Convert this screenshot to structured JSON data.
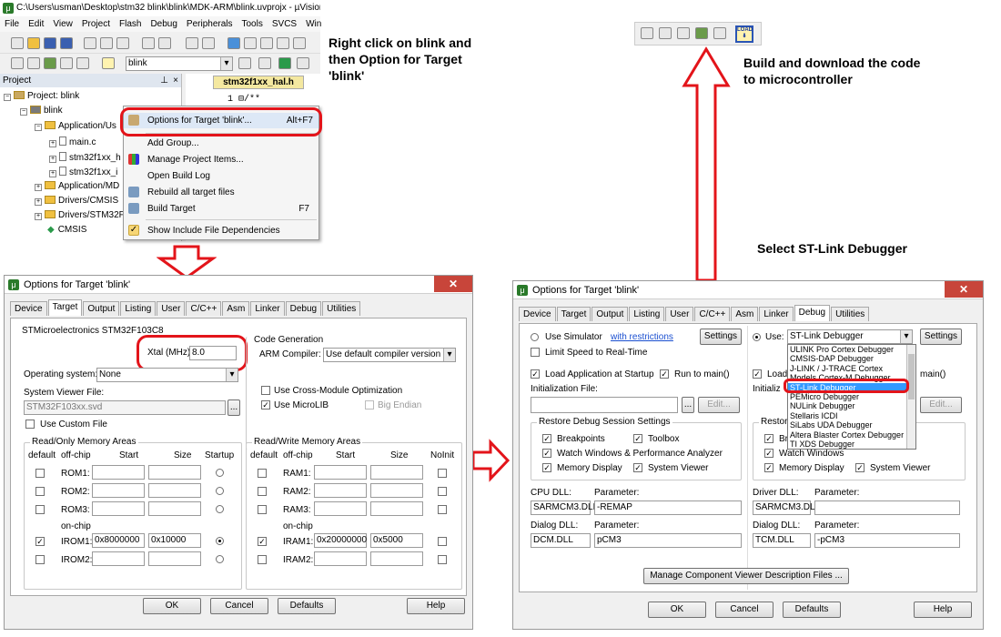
{
  "ide": {
    "title": "C:\\Users\\usman\\Desktop\\stm32 blink\\blink\\MDK-ARM\\blink.uvprojx - µVision",
    "menu": [
      "File",
      "Edit",
      "View",
      "Project",
      "Flash",
      "Debug",
      "Peripherals",
      "Tools",
      "SVCS",
      "Win"
    ],
    "target_value": "blink",
    "editor_tab": "stm32f1xx_hal.h",
    "editor_line": "1 ⊟/**",
    "project_pane_title": "Project",
    "tree": {
      "root": "Project: blink",
      "target": "blink",
      "app_user": "Application/Us",
      "main_c": "main.c",
      "file_h": "stm32f1xx_h",
      "file_i": "stm32f1xx_i",
      "app_mdk": "Application/MD",
      "cmsis": "Drivers/CMSIS",
      "drv_stm": "Drivers/STM32F",
      "cmsis2": "CMSIS"
    },
    "context_menu": [
      {
        "label": "Options for Target 'blink'...",
        "shortcut": "Alt+F7"
      },
      {
        "label": "Add Group...",
        "shortcut": ""
      },
      {
        "label": "Manage Project Items...",
        "shortcut": ""
      },
      {
        "label": "Open Build Log",
        "shortcut": ""
      },
      {
        "label": "Rebuild all target files",
        "shortcut": ""
      },
      {
        "label": "Build Target",
        "shortcut": "F7"
      },
      {
        "label": "Show Include File Dependencies",
        "shortcut": ""
      }
    ]
  },
  "captions": {
    "right_click": "Right click on blink and then Option for Target 'blink'",
    "build_download": "Build and download the code to microcontroller",
    "select_stlink": "Select ST-Link Debugger"
  },
  "target_dialog": {
    "title": "Options for Target 'blink'",
    "tabs": [
      "Device",
      "Target",
      "Output",
      "Listing",
      "User",
      "C/C++",
      "Asm",
      "Linker",
      "Debug",
      "Utilities"
    ],
    "active_tab": "Target",
    "device": "STMicroelectronics STM32F103C8",
    "xtal_label": "Xtal (MHz):",
    "xtal_value": "8.0",
    "os_label": "Operating system:",
    "os_value": "None",
    "svd_label": "System Viewer File:",
    "svd_value": "STM32F103xx.svd",
    "custom_file": "Use Custom File",
    "code_gen": "Code Generation",
    "arm_compiler_label": "ARM Compiler:",
    "arm_compiler_value": "Use default compiler version",
    "cross_module": "Use Cross-Module Optimization",
    "microlib": "Use MicroLIB",
    "big_endian": "Big Endian",
    "ro_title": "Read/Only Memory Areas",
    "rw_title": "Read/Write Memory Areas",
    "col_default": "default",
    "col_offchip": "off-chip",
    "col_start": "Start",
    "col_size": "Size",
    "col_startup": "Startup",
    "col_noinit": "NoInit",
    "on_chip": "on-chip",
    "rom": [
      "ROM1:",
      "ROM2:",
      "ROM3:",
      "IROM1:",
      "IROM2:"
    ],
    "irom1_start": "0x8000000",
    "irom1_size": "0x10000",
    "ram": [
      "RAM1:",
      "RAM2:",
      "RAM3:",
      "IRAM1:",
      "IRAM2:"
    ],
    "iram1_start": "0x20000000",
    "iram1_size": "0x5000",
    "ok": "OK",
    "cancel": "Cancel",
    "defaults": "Defaults",
    "help": "Help"
  },
  "debug_dialog": {
    "title": "Options for Target 'blink'",
    "tabs": [
      "Device",
      "Target",
      "Output",
      "Listing",
      "User",
      "C/C++",
      "Asm",
      "Linker",
      "Debug",
      "Utilities"
    ],
    "active_tab": "Debug",
    "use_simulator": "Use Simulator",
    "with_restrictions": "with restrictions",
    "settings": "Settings",
    "limit_speed": "Limit Speed to Real-Time",
    "use": "Use:",
    "debugger_value": "ST-Link Debugger",
    "debugger_options": [
      "ULINK Pro Cortex Debugger",
      "CMSIS-DAP Debugger",
      "J-LINK / J-TRACE Cortex",
      "Models Cortex-M Debugger",
      "ST-Link Debugger",
      "PEMicro Debugger",
      "NULink Debugger",
      "Stellaris ICDI",
      "SiLabs UDA Debugger",
      "Altera Blaster Cortex Debugger",
      "TI XDS Debugger"
    ],
    "load_app": "Load Application at Startup",
    "run_to_main": "Run to main()",
    "load_short": "Load",
    "main_short": "main()",
    "init_file": "Initialization File:",
    "init_short": "Initializ",
    "edit": "Edit...",
    "browse": "...",
    "restore_title": "Restore Debug Session Settings",
    "restore_short": "Restore",
    "breakpoints": "Breakpoints",
    "toolbox": "Toolbox",
    "watch": "Watch Windows & Performance Analyzer",
    "watch_short": "Watch Windows",
    "bre_short": "Bre",
    "memory": "Memory Display",
    "system_viewer": "System Viewer",
    "cpu_dll": "CPU DLL:",
    "driver_dll": "Driver DLL:",
    "parameter": "Parameter:",
    "cpu_dll_val": "SARMCM3.DLL",
    "cpu_param": "-REMAP",
    "driver_dll_val": "SARMCM3.DLL",
    "dialog_dll": "Dialog DLL:",
    "dialog_dll_val": "DCM.DLL",
    "dialog_param": "pCM3",
    "tdialog_dll_val": "TCM.DLL",
    "tdialog_param": "-pCM3",
    "manage": "Manage Component Viewer Description Files ...",
    "ok": "OK",
    "cancel": "Cancel",
    "defaults": "Defaults",
    "help": "Help"
  },
  "colors": {
    "annotation_red": "#e3141a",
    "highlight_blue": "#3399ff"
  }
}
